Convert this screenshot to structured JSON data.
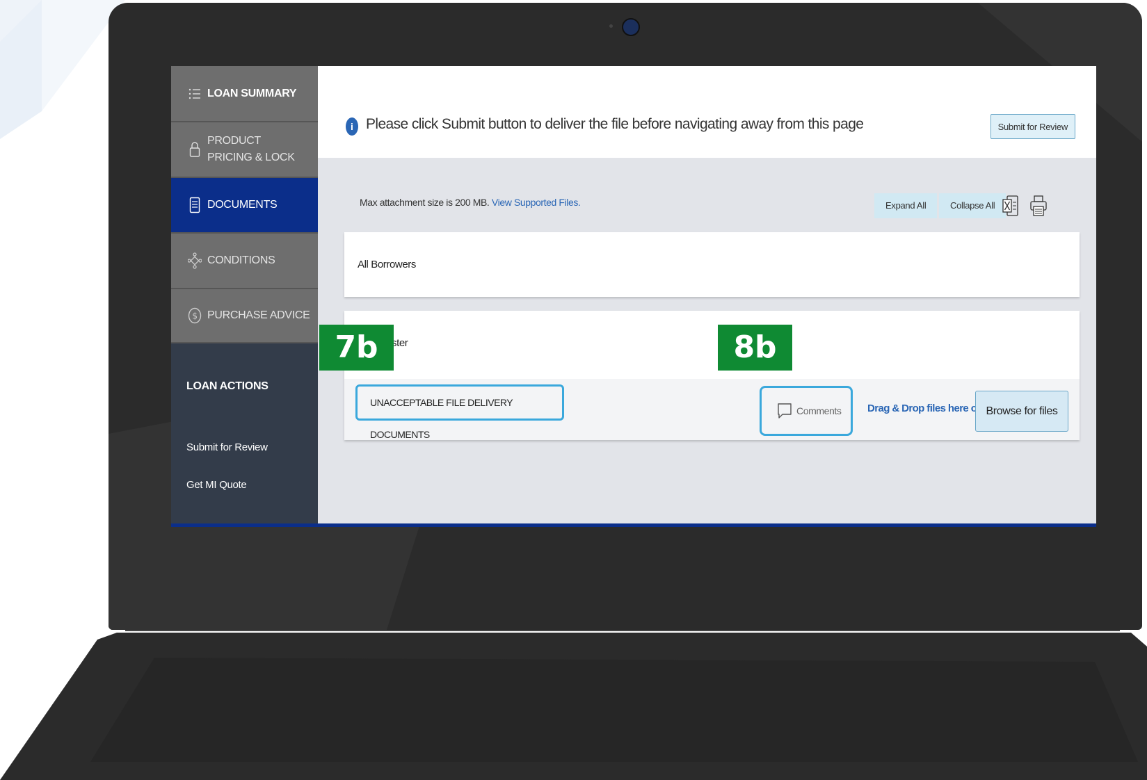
{
  "sidebar": {
    "items": [
      {
        "label": "LOAN SUMMARY",
        "icon": "list-icon"
      },
      {
        "label": "PRODUCT PRICING & LOCK",
        "icon": "lock-icon"
      },
      {
        "label": "DOCUMENTS",
        "icon": "document-icon"
      },
      {
        "label": "CONDITIONS",
        "icon": "conditions-icon"
      },
      {
        "label": "PURCHASE ADVICE",
        "icon": "dollar-circle-icon"
      }
    ],
    "loan_actions": {
      "title": "LOAN ACTIONS",
      "links": [
        "Submit for Review",
        "Get MI Quote"
      ]
    }
  },
  "banner": {
    "message": "Please click Submit button to deliver the file before navigating away from this page",
    "submit_button": "Submit for Review"
  },
  "toolbar": {
    "max_attachment": "Max attachment size is 200 MB.",
    "supported_link": "View Supported Files.",
    "expand_all": "Expand All",
    "collapse_all": "Collapse All"
  },
  "cards": {
    "all_borrowers": "All Borrowers",
    "borrower_partial": "ster",
    "document_row": {
      "name": "UNACCEPTABLE FILE DELIVERY DOCUMENTS",
      "comments": "Comments",
      "drag_drop": "Drag & Drop files here or",
      "browse": "Browse for files"
    }
  },
  "callouts": {
    "left": "7b",
    "right": "8b"
  },
  "colors": {
    "active_nav": "#0b2e8a",
    "highlight_border": "#3aa8dc",
    "callout_green": "#0f8a33",
    "link_blue": "#2a66b5"
  }
}
